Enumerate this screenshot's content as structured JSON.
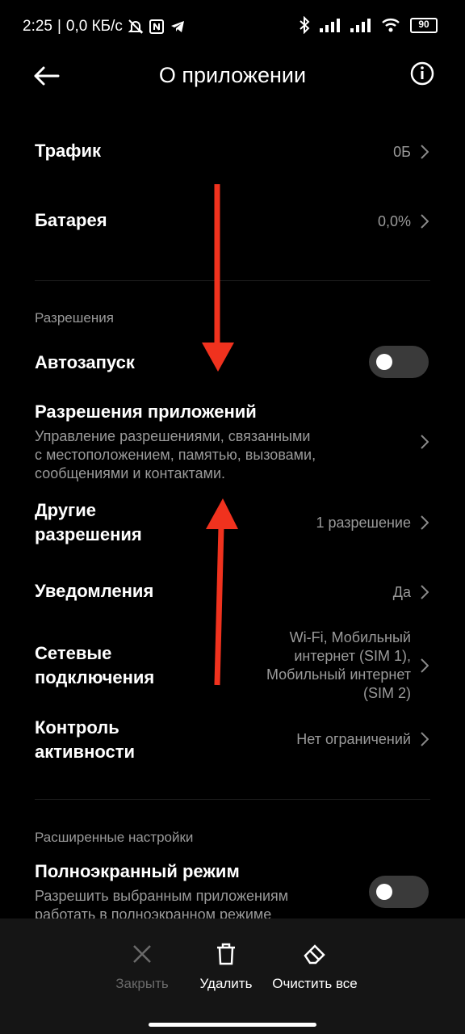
{
  "status_bar": {
    "time": "2:25",
    "network_speed": "0,0 КБ/с",
    "battery": "90",
    "icons": [
      "alarm-off-icon",
      "nfc-icon",
      "telegram-icon",
      "bluetooth-icon",
      "signal-icon",
      "signal-icon",
      "wifi-icon",
      "battery-icon"
    ]
  },
  "header": {
    "title": "О приложении",
    "back_icon": "arrow-left-icon",
    "info_icon": "info-icon"
  },
  "usage": {
    "traffic": {
      "label": "Трафик",
      "value": "0Б"
    },
    "battery": {
      "label": "Батарея",
      "value": "0,0%"
    }
  },
  "permissions": {
    "section_label": "Разрешения",
    "autostart": {
      "label": "Автозапуск",
      "enabled": false
    },
    "app_permissions": {
      "label": "Разрешения приложений",
      "description_lines": [
        "Управление разрешениями, связанными",
        "с местоположением, памятью, вызовами,",
        "сообщениями и контактами."
      ]
    },
    "other": {
      "label_lines": [
        "Другие",
        "разрешения"
      ],
      "value": "1 разрешение"
    },
    "notifications": {
      "label": "Уведомления",
      "value": "Да"
    },
    "network": {
      "label_lines": [
        "Сетевые",
        "подключения"
      ],
      "value_lines": [
        "Wi-Fi, Мобильный",
        "интернет (SIM 1),",
        "Мобильный интернет",
        "(SIM 2)"
      ]
    },
    "activity": {
      "label_lines": [
        "Контроль",
        "активности"
      ],
      "value": "Нет ограничений"
    }
  },
  "advanced": {
    "section_label": "Расширенные настройки",
    "fullscreen": {
      "label": "Полноэкранный режим",
      "description_lines": [
        "Разрешить выбранным приложениям",
        "работать в полноэкранном режиме"
      ],
      "enabled": false
    }
  },
  "bottom_bar": {
    "close": {
      "label": "Закрыть",
      "icon": "close-icon",
      "disabled": true
    },
    "delete": {
      "label": "Удалить",
      "icon": "trash-icon"
    },
    "clear": {
      "label": "Очистить все",
      "icon": "eraser-icon"
    }
  },
  "colors": {
    "background": "#000000",
    "secondary_text": "#9a9a9a",
    "annotation_arrow": "#f0321e",
    "bottom_bar": "#151515"
  }
}
